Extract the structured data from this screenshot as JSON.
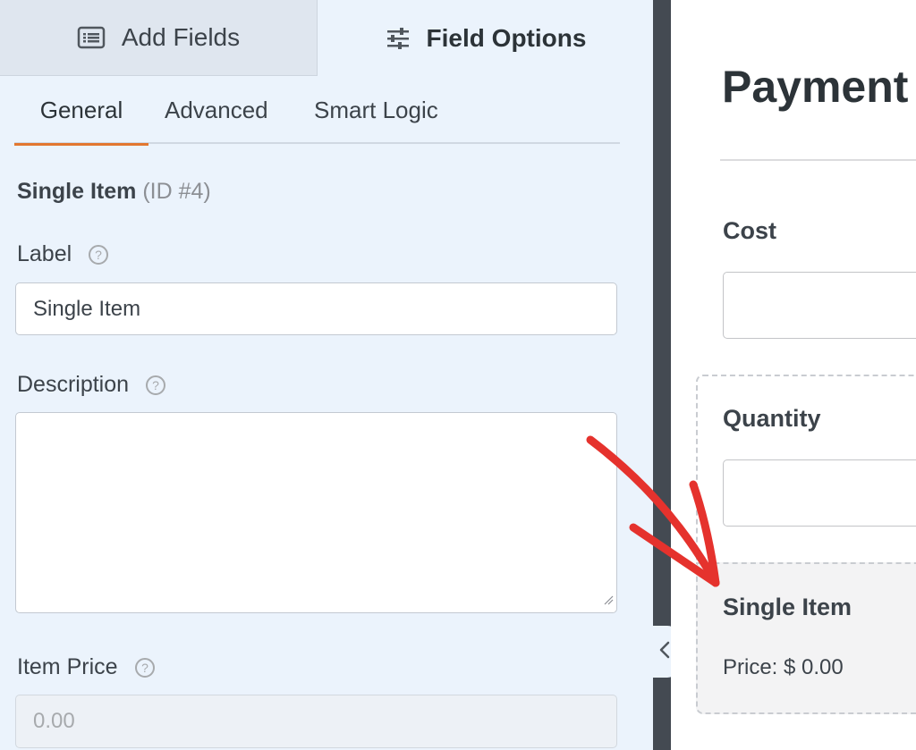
{
  "top_tabs": {
    "add_fields": "Add Fields",
    "field_options": "Field Options"
  },
  "sub_tabs": {
    "general": "General",
    "advanced": "Advanced",
    "smart_logic": "Smart Logic"
  },
  "field": {
    "name": "Single Item",
    "id_text": "(ID #4)"
  },
  "options": {
    "label_title": "Label",
    "label_value": "Single Item",
    "description_title": "Description",
    "description_value": "",
    "item_price_title": "Item Price",
    "item_price_value": "0.00"
  },
  "preview": {
    "form_title": "Payment",
    "cost_label": "Cost",
    "quantity_label": "Quantity",
    "single_item_label": "Single Item",
    "price_text": "Price: $ 0.00"
  },
  "colors": {
    "active_tab_underline": "#e27730",
    "annotation_arrow": "#e5322d",
    "divider": "#444a52"
  }
}
